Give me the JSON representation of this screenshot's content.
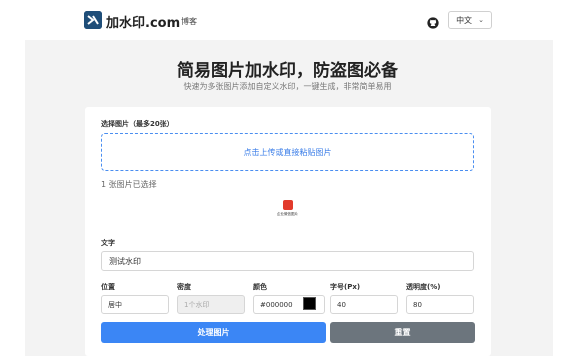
{
  "nav": {
    "brand": "加水印.com",
    "link_blog": "博客",
    "github_icon": "github-icon",
    "language": "中文"
  },
  "hero": {
    "title": "简易图片加水印，防盗图必备",
    "subtitle": "快速为多张图片添加自定义水印，一键生成，非常简单易用"
  },
  "upload": {
    "label": "选择图片（最多20张）",
    "dropzone_text": "点击上传或直接粘贴图片",
    "selected_count": "1 张图片已选择",
    "thumb_caption": "企业微信图片"
  },
  "form": {
    "text_label": "文字",
    "text_value": "测试水印",
    "position_label": "位置",
    "position_value": "居中",
    "density_label": "密度",
    "density_placeholder": "1个水印",
    "color_label": "颜色",
    "color_value": "#000000",
    "font_size_label": "字号(Px)",
    "font_size_value": "40",
    "opacity_label": "透明度(%)",
    "opacity_value": "80"
  },
  "buttons": {
    "process": "处理图片",
    "reset": "重置"
  },
  "colors": {
    "primary": "#3b86f5",
    "secondary": "#6c757d",
    "dropzone_border": "#4a8ef0"
  }
}
